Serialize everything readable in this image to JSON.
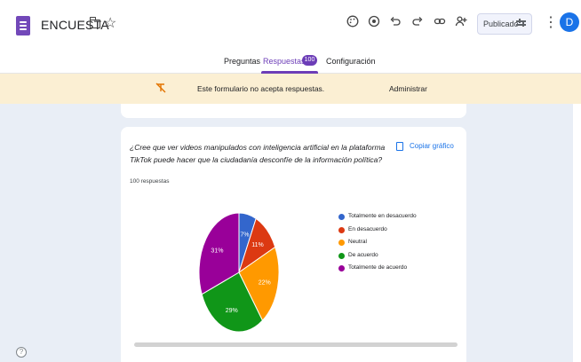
{
  "header": {
    "title": "ENCUESTA",
    "publish_label": "Publicado",
    "avatar_letter": "D",
    "icons": [
      "palette-icon",
      "preview-icon",
      "undo-icon",
      "redo-icon",
      "link-icon",
      "add-collaborator-icon"
    ]
  },
  "tabs": [
    {
      "label": "Preguntas"
    },
    {
      "label": "Respuestas",
      "badge": "100"
    },
    {
      "label": "Configuración"
    }
  ],
  "notice": {
    "text": "Este formulario no acepta respuestas.",
    "action": "Administrar"
  },
  "question_card": {
    "question": "¿Cree que ver videos manipulados con inteligencia artificial en la plataforma TikTok puede hacer que la ciudadanía desconfíe de la información política?",
    "response_count": "100 respuestas",
    "copy_label": "Copiar gráfico"
  },
  "chart_data": {
    "type": "pie",
    "slices": [
      {
        "label": "Totalmente en desacuerdo",
        "value": 7,
        "display": "7%",
        "color": "#3366cc"
      },
      {
        "label": "En desacuerdo",
        "value": 11,
        "display": "11%",
        "color": "#dc3912"
      },
      {
        "label": "Neutral",
        "value": 22,
        "display": "22%",
        "color": "#ff9900"
      },
      {
        "label": "De acuerdo",
        "value": 29,
        "display": "29%",
        "color": "#109618"
      },
      {
        "label": "Totalmente de acuerdo",
        "value": 31,
        "display": "31%",
        "color": "#990099"
      }
    ],
    "legend": "right"
  }
}
